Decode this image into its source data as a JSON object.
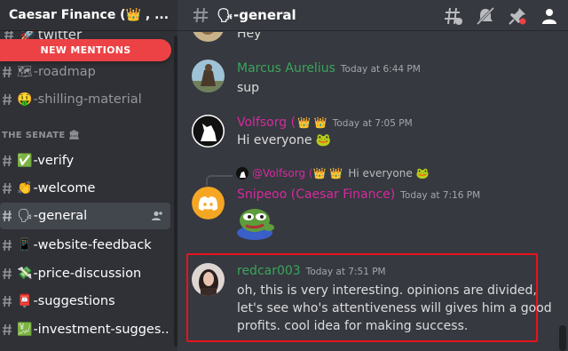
{
  "server": {
    "name": "Caesar Finance (👑 , ..."
  },
  "sidebar": {
    "new_mentions": "NEW MENTIONS",
    "partial_channel": "twitter",
    "category": "THE SENATE 🏛",
    "channels": [
      {
        "emoji": "🗺",
        "label": "-roadmap"
      },
      {
        "emoji": "🤑",
        "label": "-shilling-material"
      },
      {
        "emoji": "✅",
        "label": "-verify"
      },
      {
        "emoji": "👏",
        "label": "-welcome"
      },
      {
        "emoji": "🗣",
        "label": "-general"
      },
      {
        "emoji": "📱",
        "label": "-website-feedback"
      },
      {
        "emoji": "💸",
        "label": "-price-discussion"
      },
      {
        "emoji": "📮",
        "label": "-suggestions"
      },
      {
        "emoji": "💹",
        "label": "-investment-sugges..."
      }
    ]
  },
  "topbar": {
    "channel_title": "🗣-general"
  },
  "messages": {
    "partial": {
      "text": "Hey"
    },
    "m1": {
      "author": "Marcus Aurelius",
      "author_color": "#3ba55d",
      "time": "Today at 6:44 PM",
      "text": "sup"
    },
    "m2": {
      "author": "Volfsorg (",
      "badges": "👑 👑",
      "author_color": "#d62aa0",
      "time": "Today at 7:05 PM",
      "text": "Hi everyone 🐸"
    },
    "m3": {
      "reply_author": "@Volfsorg (👑 👑",
      "reply_text": "Hi everyone 🐸",
      "author": "Snipeoo (Caesar Finance)",
      "author_color": "#d62aa0",
      "time": "Today at 7:16 PM",
      "sticker": "pepe-sticker"
    },
    "m4": {
      "author": "redcar003",
      "author_color": "#3ba55d",
      "time": "Today at 7:51 PM",
      "line1": "oh, this is very interesting. opinions are divided,",
      "line2": "let's see who's attentiveness will gives him a good",
      "line3": "profits. cool idea for making success."
    }
  },
  "colors": {
    "background": "#36393f",
    "sidebar": "#2f3136",
    "mention_red": "#ed4245",
    "highlight": "#e8131e",
    "blurple": "#5865f2"
  },
  "icons": [
    "chevron-down-icon",
    "hashtag-icon",
    "threads-icon",
    "mute-icon",
    "pin-icon",
    "members-icon",
    "add-member-icon",
    "discord-logo-icon"
  ]
}
